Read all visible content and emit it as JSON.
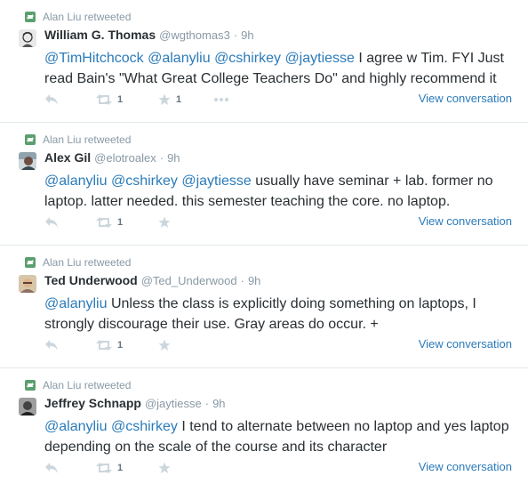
{
  "tweets": [
    {
      "retweeted_by": "Alan Liu retweeted",
      "fullname": "William G. Thomas",
      "username": "@wgthomas3",
      "sep": "·",
      "time": "9h",
      "mentions": [
        "@TimHitchcock",
        "@alanyliu",
        "@cshirkey",
        "@jaytiesse"
      ],
      "text": "I agree w Tim. FYI Just read Bain's \"What Great College Teachers Do\" and highly recommend it",
      "retweet_count": "1",
      "favorite_count": "1",
      "view_conversation": "View conversation"
    },
    {
      "retweeted_by": "Alan Liu retweeted",
      "fullname": "Alex Gil",
      "username": "@elotroalex",
      "sep": "·",
      "time": "9h",
      "mentions": [
        "@alanyliu",
        "@cshirkey",
        "@jaytiesse"
      ],
      "text": "usually have seminar + lab. former no laptop. latter needed. this semester teaching the core. no laptop.",
      "retweet_count": "1",
      "favorite_count": "",
      "view_conversation": "View conversation"
    },
    {
      "retweeted_by": "Alan Liu retweeted",
      "fullname": "Ted Underwood",
      "username": "@Ted_Underwood",
      "sep": "·",
      "time": "9h",
      "mentions": [
        "@alanyliu"
      ],
      "text": "Unless the class is explicitly doing something on laptops, I strongly discourage their use. Gray areas do occur. +",
      "retweet_count": "1",
      "favorite_count": "",
      "view_conversation": "View conversation"
    },
    {
      "retweeted_by": "Alan Liu retweeted",
      "fullname": "Jeffrey Schnapp",
      "username": "@jaytiesse",
      "sep": "·",
      "time": "9h",
      "mentions": [
        "@alanyliu",
        "@cshirkey"
      ],
      "text": "I tend to alternate between no laptop and yes laptop depending on the scale of the course and its character",
      "retweet_count": "1",
      "favorite_count": "",
      "view_conversation": "View conversation"
    }
  ],
  "colors": {
    "link": "#2b7bb9",
    "retweet_green": "#5c9f6f",
    "muted": "#8899a6",
    "icon": "#ccd6dd"
  },
  "icons": {
    "retweeted_by": "retweet-icon",
    "reply": "reply-icon",
    "retweet": "retweet-icon",
    "favorite": "star-icon",
    "more": "more-icon"
  }
}
